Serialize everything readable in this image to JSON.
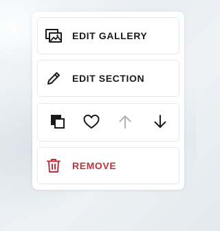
{
  "menu": {
    "edit_gallery": {
      "label": "EDIT GALLERY",
      "icon": "gallery-icon"
    },
    "edit_section": {
      "label": "EDIT SECTION",
      "icon": "pencil-icon"
    },
    "actions": {
      "duplicate_icon": "duplicate-icon",
      "favorite_icon": "heart-icon",
      "move_up_icon": "arrow-up-icon",
      "move_up_state": "disabled",
      "move_down_icon": "arrow-down-icon"
    },
    "remove": {
      "label": "REMOVE",
      "icon": "trash-icon"
    }
  },
  "colors": {
    "text": "#1a1a1a",
    "danger": "#c0303c",
    "disabled": "#b0b4b8",
    "card_border": "#e6e8ea"
  }
}
